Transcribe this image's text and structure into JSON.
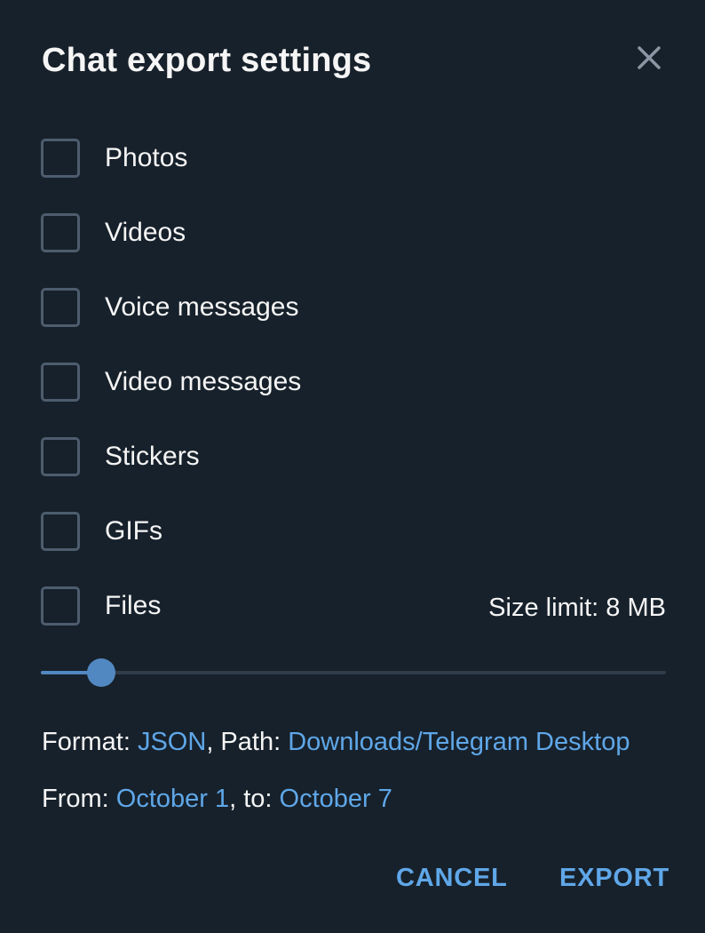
{
  "dialog": {
    "title": "Chat export settings",
    "close_icon": "close-icon"
  },
  "options": [
    {
      "label": "Photos",
      "checked": false
    },
    {
      "label": "Videos",
      "checked": false
    },
    {
      "label": "Voice messages",
      "checked": false
    },
    {
      "label": "Video messages",
      "checked": false
    },
    {
      "label": "Stickers",
      "checked": false
    },
    {
      "label": "GIFs",
      "checked": false
    },
    {
      "label": "Files",
      "checked": false
    }
  ],
  "size_limit": {
    "label": "Size limit: 8 MB",
    "slider_fraction": 0.097
  },
  "format_line": {
    "format_prefix": "Format: ",
    "format_value": "JSON",
    "path_prefix": ", Path: ",
    "path_value": "Downloads/Telegram Desktop"
  },
  "date_line": {
    "from_prefix": "From: ",
    "from_value": "October 1",
    "to_prefix": ", to: ",
    "to_value": "October 7"
  },
  "buttons": {
    "cancel_label": "CANCEL",
    "export_label": "EXPORT"
  },
  "colors": {
    "background": "#17212b",
    "accent": "#5288c1",
    "link": "#5fa7e8",
    "checkbox_border": "#4d5d6e",
    "text": "#f5f5f5"
  }
}
